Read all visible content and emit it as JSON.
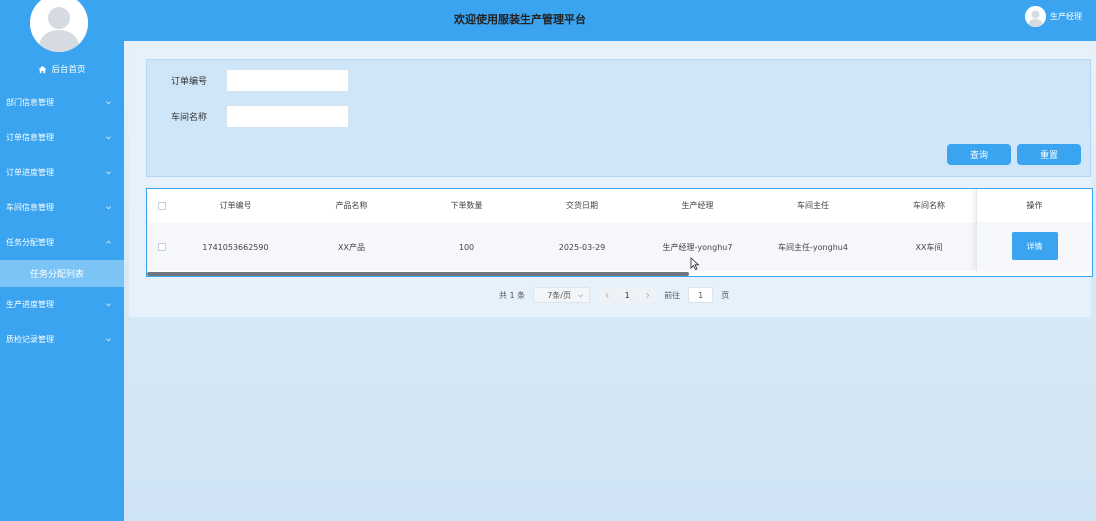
{
  "header": {
    "title": "欢迎使用服装生产管理平台",
    "user": "生产经理"
  },
  "sidebar": {
    "home": "后台首页",
    "items": [
      {
        "label": "部门信息管理"
      },
      {
        "label": "订单信息管理"
      },
      {
        "label": "订单进度管理"
      },
      {
        "label": "车间信息管理"
      },
      {
        "label": "任务分配管理"
      },
      {
        "label": "生产进度管理"
      },
      {
        "label": "质检记录管理"
      }
    ],
    "active_sub": "任务分配列表"
  },
  "search": {
    "order_no_label": "订单编号",
    "order_no_value": "",
    "workshop_label": "车间名称",
    "workshop_value": "",
    "query_btn": "查询",
    "reset_btn": "重置"
  },
  "table": {
    "headers": [
      "订单编号",
      "产品名称",
      "下单数量",
      "交货日期",
      "生产经理",
      "车间主任",
      "车间名称"
    ],
    "ops_header": "操作",
    "rows": [
      {
        "cells": [
          "1741053662590",
          "XX产品",
          "100",
          "2025-03-29",
          "生产经理-yonghu7",
          "车间主任-yonghu4",
          "XX车间"
        ],
        "action": "详情"
      }
    ]
  },
  "pagination": {
    "total": "共 1 条",
    "page_size": "7条/页",
    "current": "1",
    "goto_prefix": "前往",
    "goto_value": "1",
    "goto_suffix": "页"
  },
  "colors": {
    "primary": "#3aa4f0",
    "sub_active": "#7cc4f5"
  }
}
